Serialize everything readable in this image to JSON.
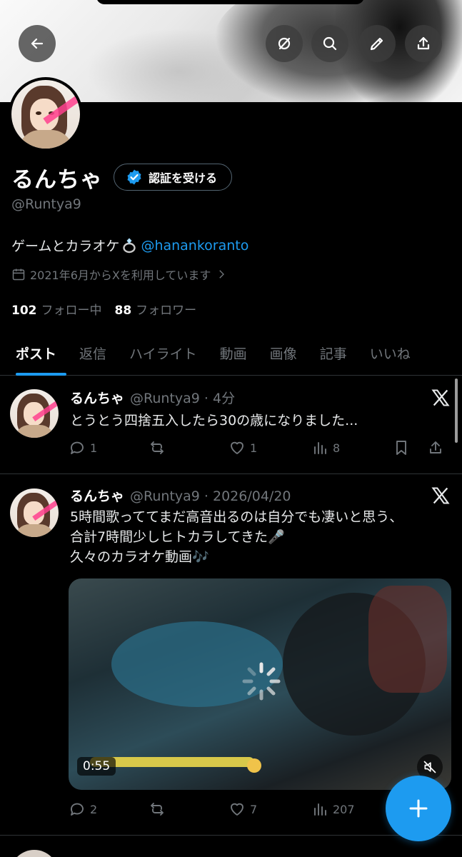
{
  "header": {
    "back_icon": "arrow-left-icon",
    "grok_icon": "grok-icon",
    "search_icon": "search-icon",
    "edit_icon": "pencil-icon",
    "share_icon": "share-icon"
  },
  "profile": {
    "name": "るんちゃ",
    "verify_label": "認証を受ける",
    "handle": "@Runtya9",
    "bio_text": "ゲームとカラオケ",
    "bio_link": "@hanankoranto",
    "joined": "2021年6月からXを利用しています",
    "following_count": "102",
    "following_label": "フォロー中",
    "followers_count": "88",
    "followers_label": "フォロワー"
  },
  "tabs": [
    {
      "label": "ポスト",
      "active": true
    },
    {
      "label": "返信"
    },
    {
      "label": "ハイライト"
    },
    {
      "label": "動画"
    },
    {
      "label": "画像"
    },
    {
      "label": "記事"
    },
    {
      "label": "いいね"
    }
  ],
  "posts": [
    {
      "name": "るんちゃ",
      "meta": "@Runtya9 · 4分",
      "text": "とうとう四捨五入したら30の歳になりました...",
      "replies": "1",
      "reposts": "",
      "likes": "1",
      "views": "8"
    },
    {
      "name": "るんちゃ",
      "meta": "@Runtya9 · 2026/04/20",
      "text_line1": "5時間歌っててまだ高音出るのは自分でも凄いと思う、",
      "text_line2": "合計7時間少しヒトカラしてきた🎤",
      "text_line3": "久々のカラオケ動画🎶",
      "video_duration": "0:55",
      "replies": "2",
      "reposts": "",
      "likes": "7",
      "views": "207"
    }
  ],
  "colors": {
    "accent": "#1d9bf0",
    "background": "#000000",
    "muted_text": "#71767b",
    "border": "#2f3336"
  }
}
